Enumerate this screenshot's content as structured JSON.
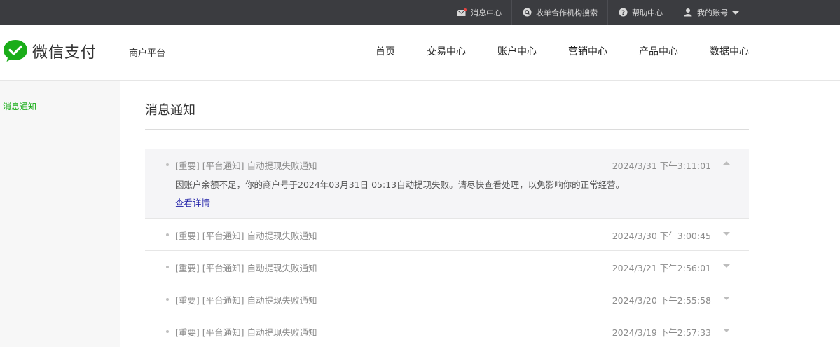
{
  "topbar": {
    "items": [
      {
        "icon": "mail-icon",
        "label": "消息中心"
      },
      {
        "icon": "search-org-icon",
        "label": "收单合作机构搜索"
      },
      {
        "icon": "help-icon",
        "label": "帮助中心"
      },
      {
        "icon": "user-icon",
        "label": "我的账号"
      }
    ]
  },
  "header": {
    "logo_text": "微信支付",
    "platform": "商户平台",
    "nav": [
      "首页",
      "交易中心",
      "账户中心",
      "营销中心",
      "产品中心",
      "数据中心"
    ]
  },
  "sidebar": {
    "items": [
      {
        "label": "消息通知"
      }
    ]
  },
  "main": {
    "title": "消息通知",
    "messages": [
      {
        "title": "[重要] [平台通知] 自动提现失败通知",
        "time": "2024/3/31 下午3:11:01",
        "body": "因账户余额不足，你的商户号于2024年03月31日 05:13自动提现失败。请尽快查看处理，以免影响你的正常经营。",
        "link": "查看详情",
        "expanded": true
      },
      {
        "title": "[重要] [平台通知] 自动提现失败通知",
        "time": "2024/3/30 下午3:00:45",
        "expanded": false
      },
      {
        "title": "[重要] [平台通知] 自动提现失败通知",
        "time": "2024/3/21 下午2:56:01",
        "expanded": false
      },
      {
        "title": "[重要] [平台通知] 自动提现失败通知",
        "time": "2024/3/20 下午2:55:58",
        "expanded": false
      },
      {
        "title": "[重要] [平台通知] 自动提现失败通知",
        "time": "2024/3/19 下午2:57:33",
        "expanded": false
      }
    ]
  },
  "colors": {
    "topbar_bg": "#3b3c40",
    "brand_green": "#1aad19",
    "link_blue": "#1a1aa6",
    "expanded_bg": "#f5f5f7"
  }
}
